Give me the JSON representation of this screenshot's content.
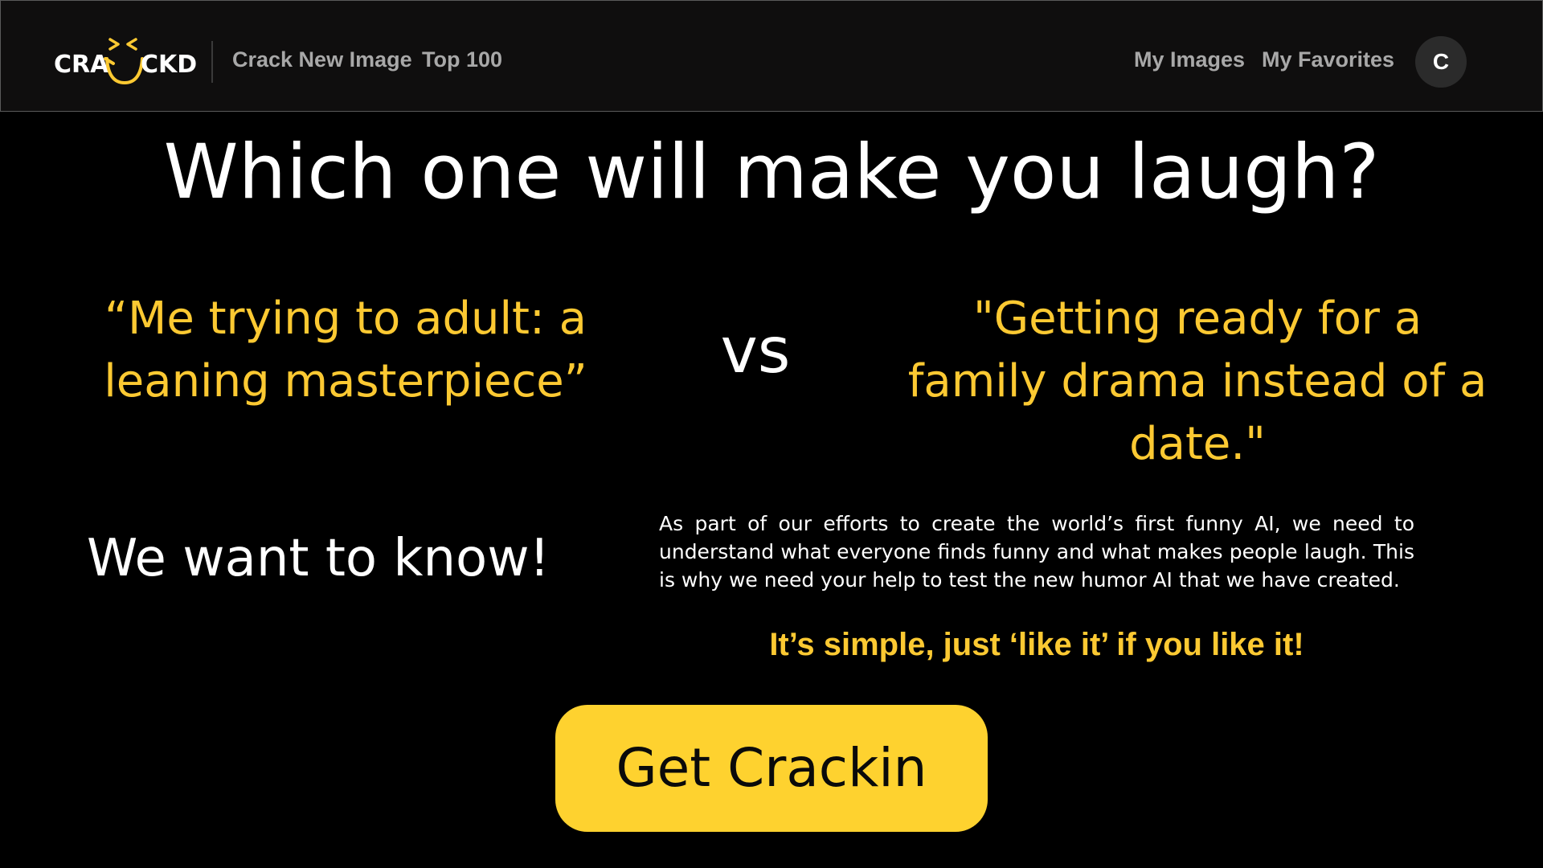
{
  "nav": {
    "logo_left": "CRA",
    "logo_right": "CKD",
    "links_left": [
      "Crack New Image",
      "Top 100"
    ],
    "links_right": [
      "My Images",
      "My Favorites"
    ],
    "avatar_initial": "C"
  },
  "hero": {
    "headline": "Which one will make you laugh?",
    "caption_left": "“Me trying to adult: a leaning masterpiece”",
    "vs": "vs",
    "caption_right": "\"Getting ready for a family drama instead of a date.\""
  },
  "info": {
    "heading": "We want to know!",
    "description": "As part of our efforts to create the world’s first funny AI, we need to understand what everyone finds funny and what makes people laugh. This is why we need your help to test the new humor AI that we have created.",
    "simple": "It’s simple, just ‘like it’ if you like it!"
  },
  "cta": {
    "label": "Get Crackin"
  },
  "colors": {
    "accent_yellow": "#fcc932",
    "button_yellow": "#fed22f",
    "background": "#000000",
    "nav_background": "#0f0e0e",
    "nav_link": "#a8a8a8"
  }
}
